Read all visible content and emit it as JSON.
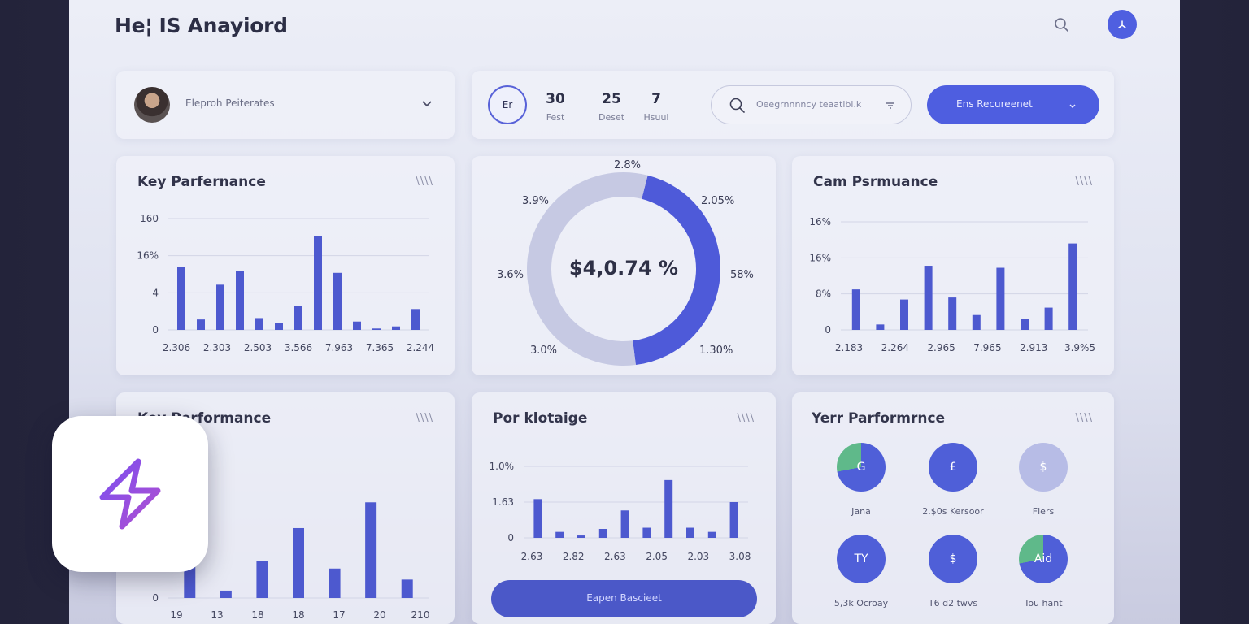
{
  "app": {
    "title": "He¦ IS Anayiord"
  },
  "user": {
    "name": "Eleproh Peiterates"
  },
  "stats": {
    "badge": "Er",
    "items": [
      {
        "value": "30",
        "label": "Fest"
      },
      {
        "value": "25",
        "label": "Deset"
      },
      {
        "value": "7",
        "label": "Hsuul"
      }
    ]
  },
  "search": {
    "text": "Oeegrnnnncy teaatibl.k"
  },
  "primary_button": {
    "label": "Ens Recureenet"
  },
  "card1": {
    "title": "Key Parfernance",
    "more": "\\\\\\\\",
    "chart_data": {
      "type": "bar",
      "yticks": [
        "160",
        "16%",
        "4",
        "0"
      ],
      "xticks": [
        "2.306",
        "2.303",
        "2.503",
        "3.566",
        "7.963",
        "7.365",
        "2.244"
      ],
      "values": [
        90,
        15,
        65,
        85,
        17,
        10,
        35,
        135,
        82,
        12,
        2,
        5,
        30
      ],
      "ylim": [
        0,
        160
      ]
    }
  },
  "card2": {
    "chart_data": {
      "type": "pie",
      "center_value": "$4,0.74 %",
      "labels": [
        "2.8%",
        "2.05%",
        "58%",
        "1.30%",
        "3.0%",
        "3.6%",
        "3.9%"
      ],
      "segments": [
        {
          "name": "accent",
          "value": 44,
          "color": "#4e5ad9"
        },
        {
          "name": "rest",
          "value": 56,
          "color": "#c6c9e3"
        }
      ]
    }
  },
  "card3": {
    "title": "Cam Psrmuance",
    "more": "\\\\\\\\",
    "chart_data": {
      "type": "bar",
      "yticks": [
        "16%",
        "16%",
        "8%",
        "0"
      ],
      "xticks": [
        "2.183",
        "2.264",
        "2.965",
        "7.965",
        "2.913",
        "3.9%5"
      ],
      "values": [
        60,
        8,
        45,
        95,
        48,
        22,
        92,
        16,
        33,
        128
      ],
      "ylim": [
        0,
        160
      ]
    }
  },
  "card4": {
    "title": "Key Performance",
    "more": "\\\\\\\\",
    "chart_data": {
      "type": "bar",
      "yticks": [
        "0"
      ],
      "xticks": [
        "19",
        "13",
        "18",
        "18",
        "17",
        "20",
        "210"
      ],
      "values": [
        60,
        10,
        50,
        95,
        40,
        130,
        25
      ],
      "ylim": [
        0,
        180
      ]
    }
  },
  "card5": {
    "title": "Por klotaige",
    "more": "\\\\\\\\",
    "button": "Eapen Bascieet",
    "chart_data": {
      "type": "bar",
      "yticks": [
        "1.0%",
        "1.63",
        "0"
      ],
      "xticks": [
        "2.63",
        "2.82",
        "2.63",
        "2.05",
        "2.03",
        "3.08"
      ],
      "values": [
        65,
        10,
        4,
        15,
        46,
        17,
        97,
        17,
        10,
        60
      ],
      "ylim": [
        0,
        120
      ]
    }
  },
  "card6": {
    "title": "Yerr Parformrnce",
    "more": "\\\\\\\\",
    "items": [
      {
        "label": "Jana",
        "glyph": "G"
      },
      {
        "label": "2.$0s Kersoor",
        "glyph": "£"
      },
      {
        "label": "Flers",
        "glyph": "$"
      },
      {
        "label": "5,3k Ocroay",
        "glyph": "TY"
      },
      {
        "label": "T6 d2 twvs",
        "glyph": "$"
      },
      {
        "label": "Tou hant",
        "glyph": "Aid"
      }
    ]
  },
  "overlay_app": {
    "icon": "lightning-bolt-icon",
    "colors": [
      "#7b4ff0",
      "#b04fd0"
    ]
  }
}
